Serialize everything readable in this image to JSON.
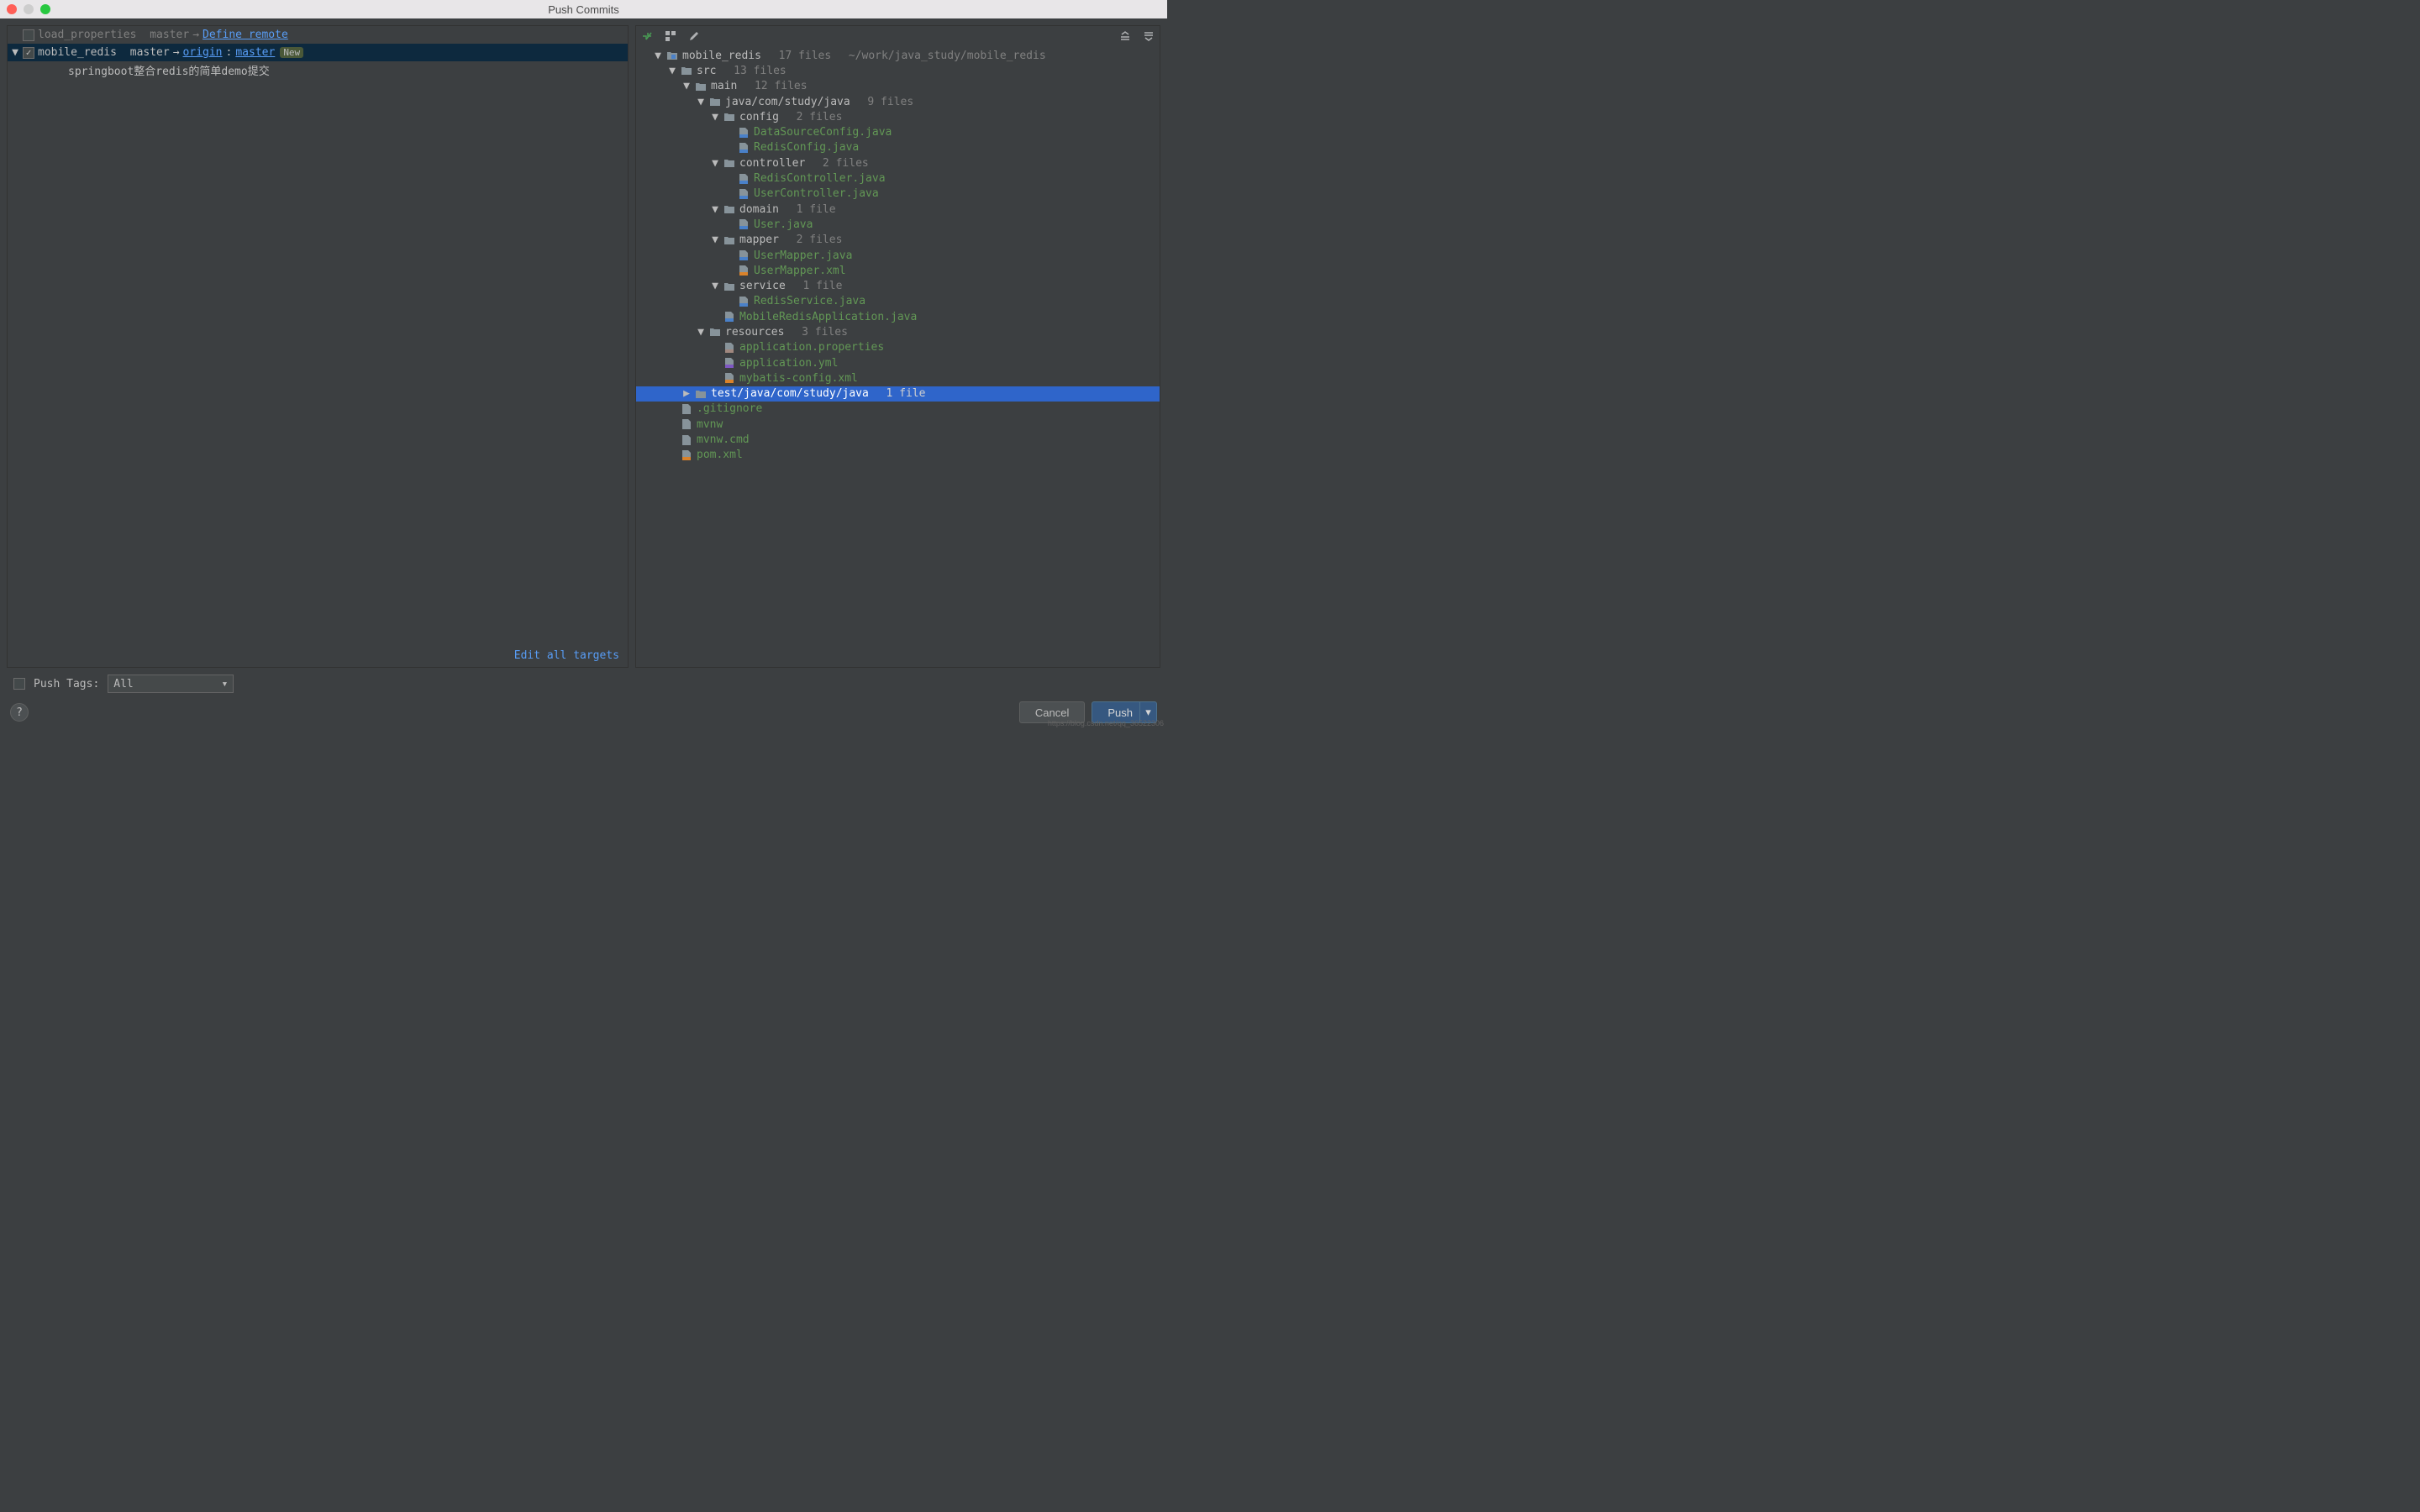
{
  "window": {
    "title": "Push Commits"
  },
  "left": {
    "modules": [
      {
        "name": "load_properties",
        "checked": false,
        "local_branch": "master",
        "remote_action": "Define remote"
      },
      {
        "name": "mobile_redis",
        "checked": true,
        "local_branch": "master",
        "remote_name": "origin",
        "remote_branch": "master",
        "badge": "New",
        "selected": true
      }
    ],
    "commit_message": "springboot整合redis的简单demo提交",
    "edit_all_targets": "Edit all targets"
  },
  "tree": {
    "root": {
      "name": "mobile_redis",
      "count": "17 files",
      "path": "~/work/java_study/mobile_redis"
    },
    "nodes": [
      {
        "depth": 1,
        "type": "folder",
        "name": "src",
        "count": "13 files",
        "expanded": true
      },
      {
        "depth": 2,
        "type": "folder",
        "name": "main",
        "count": "12 files",
        "expanded": true
      },
      {
        "depth": 3,
        "type": "folder",
        "name": "java/com/study/java",
        "count": "9 files",
        "expanded": true
      },
      {
        "depth": 4,
        "type": "folder",
        "name": "config",
        "count": "2 files",
        "expanded": true
      },
      {
        "depth": 5,
        "type": "file-java",
        "name": "DataSourceConfig.java"
      },
      {
        "depth": 5,
        "type": "file-java",
        "name": "RedisConfig.java"
      },
      {
        "depth": 4,
        "type": "folder",
        "name": "controller",
        "count": "2 files",
        "expanded": true
      },
      {
        "depth": 5,
        "type": "file-java",
        "name": "RedisController.java"
      },
      {
        "depth": 5,
        "type": "file-java",
        "name": "UserController.java"
      },
      {
        "depth": 4,
        "type": "folder",
        "name": "domain",
        "count": "1 file",
        "expanded": true
      },
      {
        "depth": 5,
        "type": "file-java",
        "name": "User.java"
      },
      {
        "depth": 4,
        "type": "folder",
        "name": "mapper",
        "count": "2 files",
        "expanded": true
      },
      {
        "depth": 5,
        "type": "file-java",
        "name": "UserMapper.java"
      },
      {
        "depth": 5,
        "type": "file-xml",
        "name": "UserMapper.xml"
      },
      {
        "depth": 4,
        "type": "folder",
        "name": "service",
        "count": "1 file",
        "expanded": true
      },
      {
        "depth": 5,
        "type": "file-java",
        "name": "RedisService.java"
      },
      {
        "depth": 4,
        "type": "file-java",
        "name": "MobileRedisApplication.java"
      },
      {
        "depth": 3,
        "type": "folder",
        "name": "resources",
        "count": "3 files",
        "expanded": true
      },
      {
        "depth": 4,
        "type": "file-props",
        "name": "application.properties"
      },
      {
        "depth": 4,
        "type": "file-yml",
        "name": "application.yml"
      },
      {
        "depth": 4,
        "type": "file-xml",
        "name": "mybatis-config.xml"
      },
      {
        "depth": 2,
        "type": "folder",
        "name": "test/java/com/study/java",
        "count": "1 file",
        "expanded": false,
        "selected": true
      },
      {
        "depth": 1,
        "type": "file-txt",
        "name": ".gitignore"
      },
      {
        "depth": 1,
        "type": "file-txt",
        "name": "mvnw"
      },
      {
        "depth": 1,
        "type": "file-txt",
        "name": "mvnw.cmd"
      },
      {
        "depth": 1,
        "type": "file-xml",
        "name": "pom.xml"
      }
    ]
  },
  "bottom": {
    "push_tags_label": "Push Tags:",
    "push_tags_value": "All",
    "cancel": "Cancel",
    "push": "Push",
    "help": "?"
  },
  "watermark": "https://blog.csdn.net/qq_36522306"
}
